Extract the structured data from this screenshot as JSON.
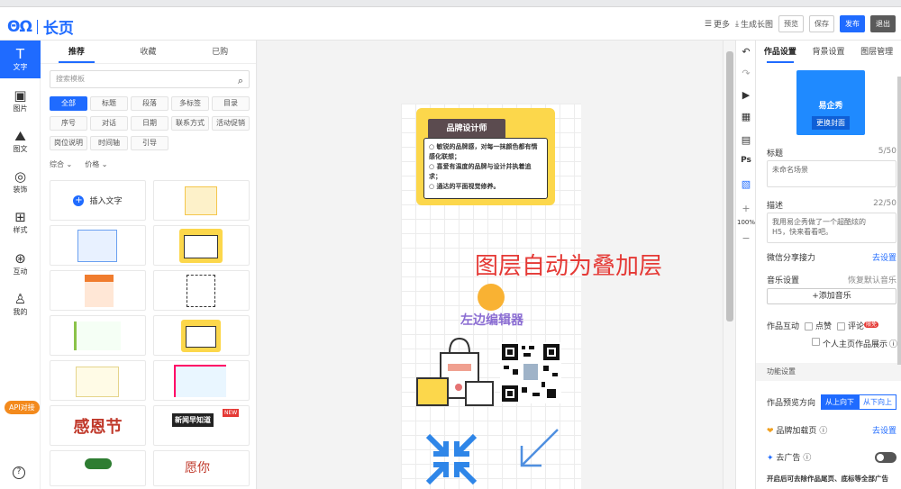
{
  "header": {
    "logo_mark": "ΘΩ",
    "logo_text": "长页",
    "more": "更多",
    "long_image": "生成长图",
    "preview": "预览",
    "save": "保存",
    "publish": "发布",
    "exit": "退出"
  },
  "leftbar": {
    "items": [
      {
        "label": "文字",
        "icon": "text-icon"
      },
      {
        "label": "图片",
        "icon": "image-icon"
      },
      {
        "label": "图文",
        "icon": "image-text-icon"
      },
      {
        "label": "装饰",
        "icon": "palette-icon"
      },
      {
        "label": "样式",
        "icon": "grid-icon"
      },
      {
        "label": "互动",
        "icon": "interact-icon"
      },
      {
        "label": "我的",
        "icon": "user-icon"
      }
    ],
    "api": "API对接"
  },
  "panel": {
    "tabs": [
      "推荐",
      "收藏",
      "已购"
    ],
    "search_placeholder": "搜索模板",
    "chips": [
      "全部",
      "标题",
      "段落",
      "多标签",
      "目录",
      "序号",
      "对话",
      "日期",
      "联系方式",
      "活动促销",
      "岗位说明",
      "时间轴",
      "引导"
    ],
    "filter_1": "综合",
    "filter_2": "价格",
    "insert_text": "插入文字",
    "thumb_festival": "感恩节",
    "thumb_news": "新闻早知道",
    "thumb_news_badge": "NEW",
    "thumb_wish": "愿你"
  },
  "canvas": {
    "card_title": "品牌设计师",
    "card_lines": [
      "敏锐的品牌感，对每一抹颜色都有情感化联想；",
      "喜爱有温度的品牌与设计并执着追求；",
      "通达的平面视觉修养。"
    ],
    "overlay": "图层自动为叠加层",
    "editor_text": "左边编辑器"
  },
  "tools": {
    "zoom": "100%",
    "ps": "Ps",
    "plus": "+",
    "minus": "−"
  },
  "right": {
    "tabs": [
      "作品设置",
      "背景设置",
      "图层管理"
    ],
    "cover_brand": "易企秀",
    "cover_change": "更换封面",
    "title_label": "标题",
    "title_count": "5/50",
    "title_value": "未命名场景",
    "desc_label": "描述",
    "desc_count": "22/50",
    "desc_value": "我用易企秀做了一个超酷炫的H5，快来看看吧。",
    "wechat_label": "微信分享接力",
    "wechat_action": "去设置",
    "music_label": "音乐设置",
    "music_action": "恢复默认音乐",
    "music_add": "+添加音乐",
    "interact_label": "作品互动",
    "like": "点赞",
    "comment": "评论",
    "comment_badge": "限免",
    "profile_show": "个人主页作品展示",
    "func_section": "功能设置",
    "direction_label": "作品预览方向",
    "dir_top": "从上向下",
    "dir_bottom": "从下向上",
    "brand_page": "品牌加载页",
    "brand_action": "去设置",
    "remove_ads": "去广告",
    "ads_note": "开启后可去除作品尾页、底标等全部广告"
  }
}
